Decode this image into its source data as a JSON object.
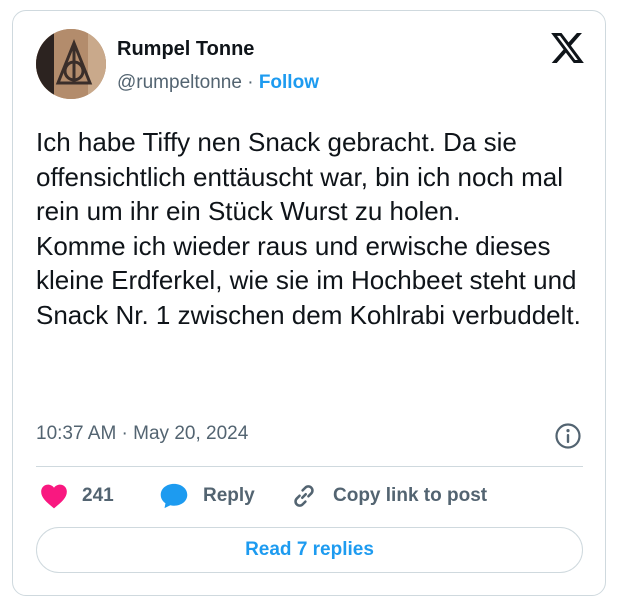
{
  "author": {
    "name": "Rumpel Tonne",
    "handle": "@rumpeltonne",
    "separator": "·",
    "follow_label": "Follow"
  },
  "tweet": {
    "text": "Ich habe Tiffy nen Snack gebracht. Da sie offensichtlich enttäuscht war, bin ich noch mal rein um ihr ein Stück Wurst zu holen.\nKomme ich wieder raus und erwische dieses kleine Erdferkel, wie sie im Hochbeet steht und Snack Nr. 1 zwischen dem Kohlrabi verbuddelt.",
    "timestamp": "10:37 AM · May 20, 2024"
  },
  "actions": {
    "like_count": "241",
    "reply_label": "Reply",
    "copy_link_label": "Copy link to post"
  },
  "read_replies_label": "Read 7 replies",
  "icons": {
    "brand": "x-logo-icon",
    "like": "heart-icon",
    "reply": "speech-bubble-icon",
    "copy": "link-icon",
    "info": "info-icon"
  },
  "colors": {
    "accent": "#1d9bf0",
    "like": "#f91880",
    "muted_text": "#536471",
    "border": "#cfd9de"
  }
}
